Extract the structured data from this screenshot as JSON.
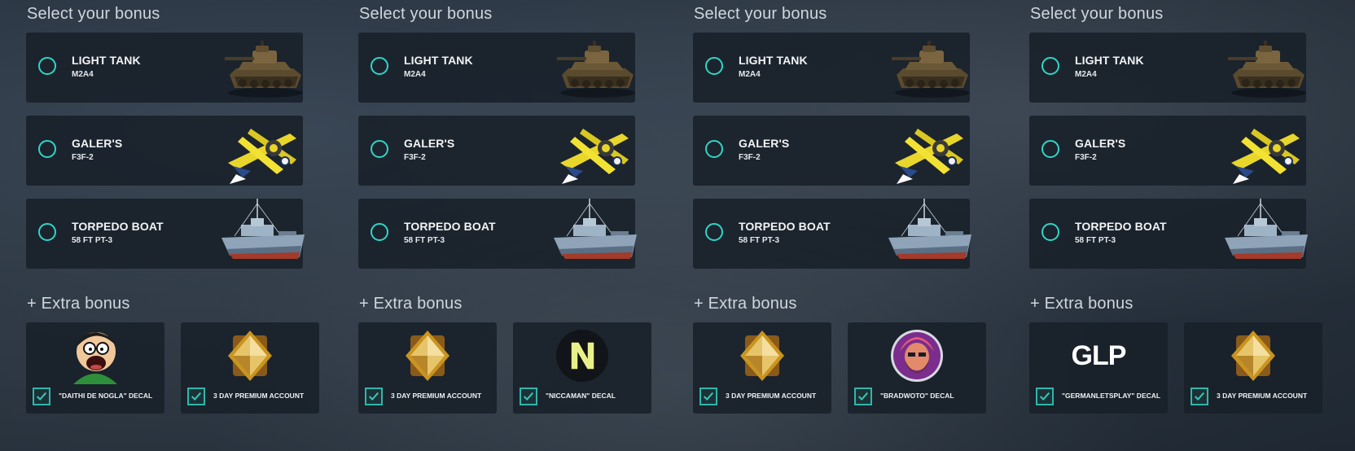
{
  "select_title": "Select your bonus",
  "extra_title": "+ Extra bonus",
  "accent_color": "#2fd6c7",
  "options": [
    {
      "title": "LIGHT TANK",
      "subtitle": "M2A4",
      "icon": "tank-icon"
    },
    {
      "title": "GALER'S",
      "subtitle": "F3F-2",
      "icon": "plane-icon"
    },
    {
      "title": "TORPEDO BOAT",
      "subtitle": "58 FT PT-3",
      "icon": "boat-icon"
    }
  ],
  "columns": [
    {
      "extras": [
        {
          "label": "\"DAITHI DE NOGLA\" DECAL",
          "icon": "cartoon-face-icon"
        },
        {
          "label": "3 DAY PREMIUM ACCOUNT",
          "icon": "premium-diamond-icon"
        }
      ]
    },
    {
      "extras": [
        {
          "label": "3 DAY PREMIUM ACCOUNT",
          "icon": "premium-diamond-icon"
        },
        {
          "label": "\"NICCAMAN\" DECAL",
          "icon": "n-logo-icon"
        }
      ]
    },
    {
      "extras": [
        {
          "label": "3 DAY PREMIUM ACCOUNT",
          "icon": "premium-diamond-icon"
        },
        {
          "label": "\"BRADWOTO\" DECAL",
          "icon": "bearded-avatar-icon"
        }
      ]
    },
    {
      "extras": [
        {
          "label": "\"GERMANLETSPLAY\" DECAL",
          "icon": "glp-logo-icon",
          "logo_text": "GLP"
        },
        {
          "label": "3 DAY PREMIUM ACCOUNT",
          "icon": "premium-diamond-icon"
        }
      ]
    }
  ]
}
